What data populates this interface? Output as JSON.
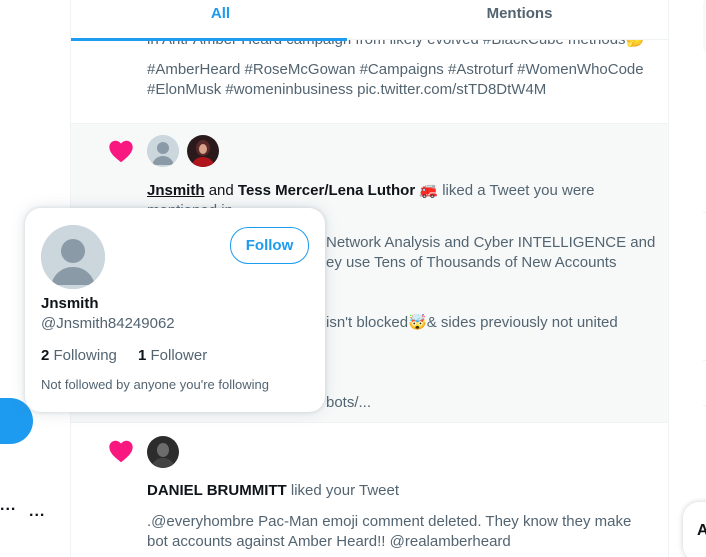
{
  "tabs": {
    "all": "All",
    "mentions": "Mentions"
  },
  "notif1": {
    "cut_line": "in Anti-Amber Heard campaign from likely evolved #BlackCube methods🤔",
    "hashtags_line1": "#AmberHeard #RoseMcGowan #Campaigns #Astroturf #WomenWhoCode",
    "hashtags_line2": "#ElonMusk #womeninbusiness pic.twitter.com/stTD8DtW4M"
  },
  "notif2": {
    "user1": "Jnsmith",
    "and": "and",
    "user2": "Tess Mercer/Lena Luthor 🚒",
    "action": "liked a Tweet you were",
    "action_cont": "mentioned in",
    "body_line1": "Network Analysis and Cyber  INTELLIGENCE and",
    "body_line2": "ey use Tens of Thousands of New Accounts",
    "body_line3": "isn't blocked🤯& sides previously not united",
    "body_line4": "bots/..."
  },
  "notif3": {
    "user": "DANIEL BRUMMITT",
    "action": "liked your Tweet",
    "body_line1": ".@everyhombre Pac-Man emoji comment deleted. They know they make",
    "body_line2": "bot accounts against Amber Heard!! @realamberheard"
  },
  "hover_card": {
    "name": "Jnsmith",
    "handle": "@Jnsmith84249062",
    "following_count": "2",
    "following_label": "Following",
    "followers_count": "1",
    "followers_label": "Follower",
    "note": "Not followed by anyone you're following",
    "follow_button": "Follow"
  },
  "left_rail": {
    "more_1": "...",
    "more_2": "..."
  },
  "right_side": {
    "pill_letter": "A"
  },
  "colors": {
    "accent": "#1d9bf0",
    "heart": "#f91880",
    "muted": "#536471",
    "text": "#0f1419"
  },
  "icons": {
    "heart": "heart-icon",
    "default_avatar": "default-avatar-icon"
  }
}
